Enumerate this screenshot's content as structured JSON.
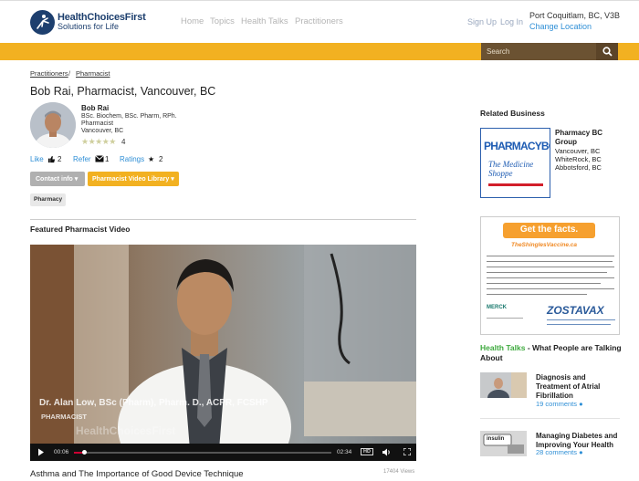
{
  "header": {
    "logo_name": "HealthChoicesFirst",
    "logo_tagline": "Solutions for Life",
    "nav": [
      "Home",
      "Topics",
      "Health Talks",
      "Practitioners"
    ],
    "sign_up": "Sign Up",
    "log_in": "Log In",
    "location": "Port Coquitlam, BC, V3B",
    "change_location": "Change Location",
    "search_placeholder": "Search"
  },
  "breadcrumb": [
    "Practitioners",
    "Pharmacist"
  ],
  "breadcrumb_sep": "/",
  "page_title": "Bob Rai, Pharmacist, Vancouver, BC",
  "profile": {
    "name": "Bob Rai",
    "degrees": "BSc. Biochem, BSc. Pharm, RPh.",
    "role": "Pharmacist",
    "city": "Vancouver, BC",
    "stars": "★★★★★",
    "rating_count": "4"
  },
  "actions": {
    "like": "Like",
    "like_count": "2",
    "refer": "Refer",
    "refer_count": "1",
    "ratings": "Ratings",
    "ratings_count": "2"
  },
  "buttons": {
    "contact": "Contact info ▾",
    "library": "Pharmacist Video Library ▾"
  },
  "tag": "Pharmacy",
  "featured": {
    "heading": "Featured Pharmacist Video",
    "overlay_name": "Dr. Alan Low, BSc (Pharm), Pharm. D., ACPR, FCSHP",
    "overlay_role": "PHARMACIST",
    "overlay_brand": "HealthChoicesFirst",
    "time_current": "00:06",
    "time_total": "02:34",
    "hd": "HD",
    "progress": 0.04,
    "title": "Asthma and The Importance of Good Device Technique",
    "views": "17404 Views"
  },
  "sidebar": {
    "related_heading": "Related Business",
    "business": {
      "logo_line1": "PHARMACYBC",
      "logo_line2": "The Medicine Shoppe",
      "name": "Pharmacy BC Group",
      "cities": [
        "Vancouver, BC",
        "WhiteRock, BC",
        "Abbotsford, BC"
      ]
    },
    "ad": {
      "banner": "Get the facts.",
      "url": "TheShinglesVaccine.ca",
      "brand": "ZOSTAVAX",
      "sponsor": "MERCK"
    },
    "talks_heading_a": "Health Talks",
    "talks_heading_b": " - What People are Talking About",
    "talks": [
      {
        "title": "Diagnosis and Treatment of Atrial Fibrillation",
        "comments": "19 comments"
      },
      {
        "title": "Managing Diabetes and Improving Your Health",
        "comments": "28 comments"
      }
    ],
    "thumb2_label": "insulin"
  },
  "colors": {
    "accent": "#f2b121",
    "brand": "#1d3f6e",
    "link": "#2f8fd6"
  }
}
